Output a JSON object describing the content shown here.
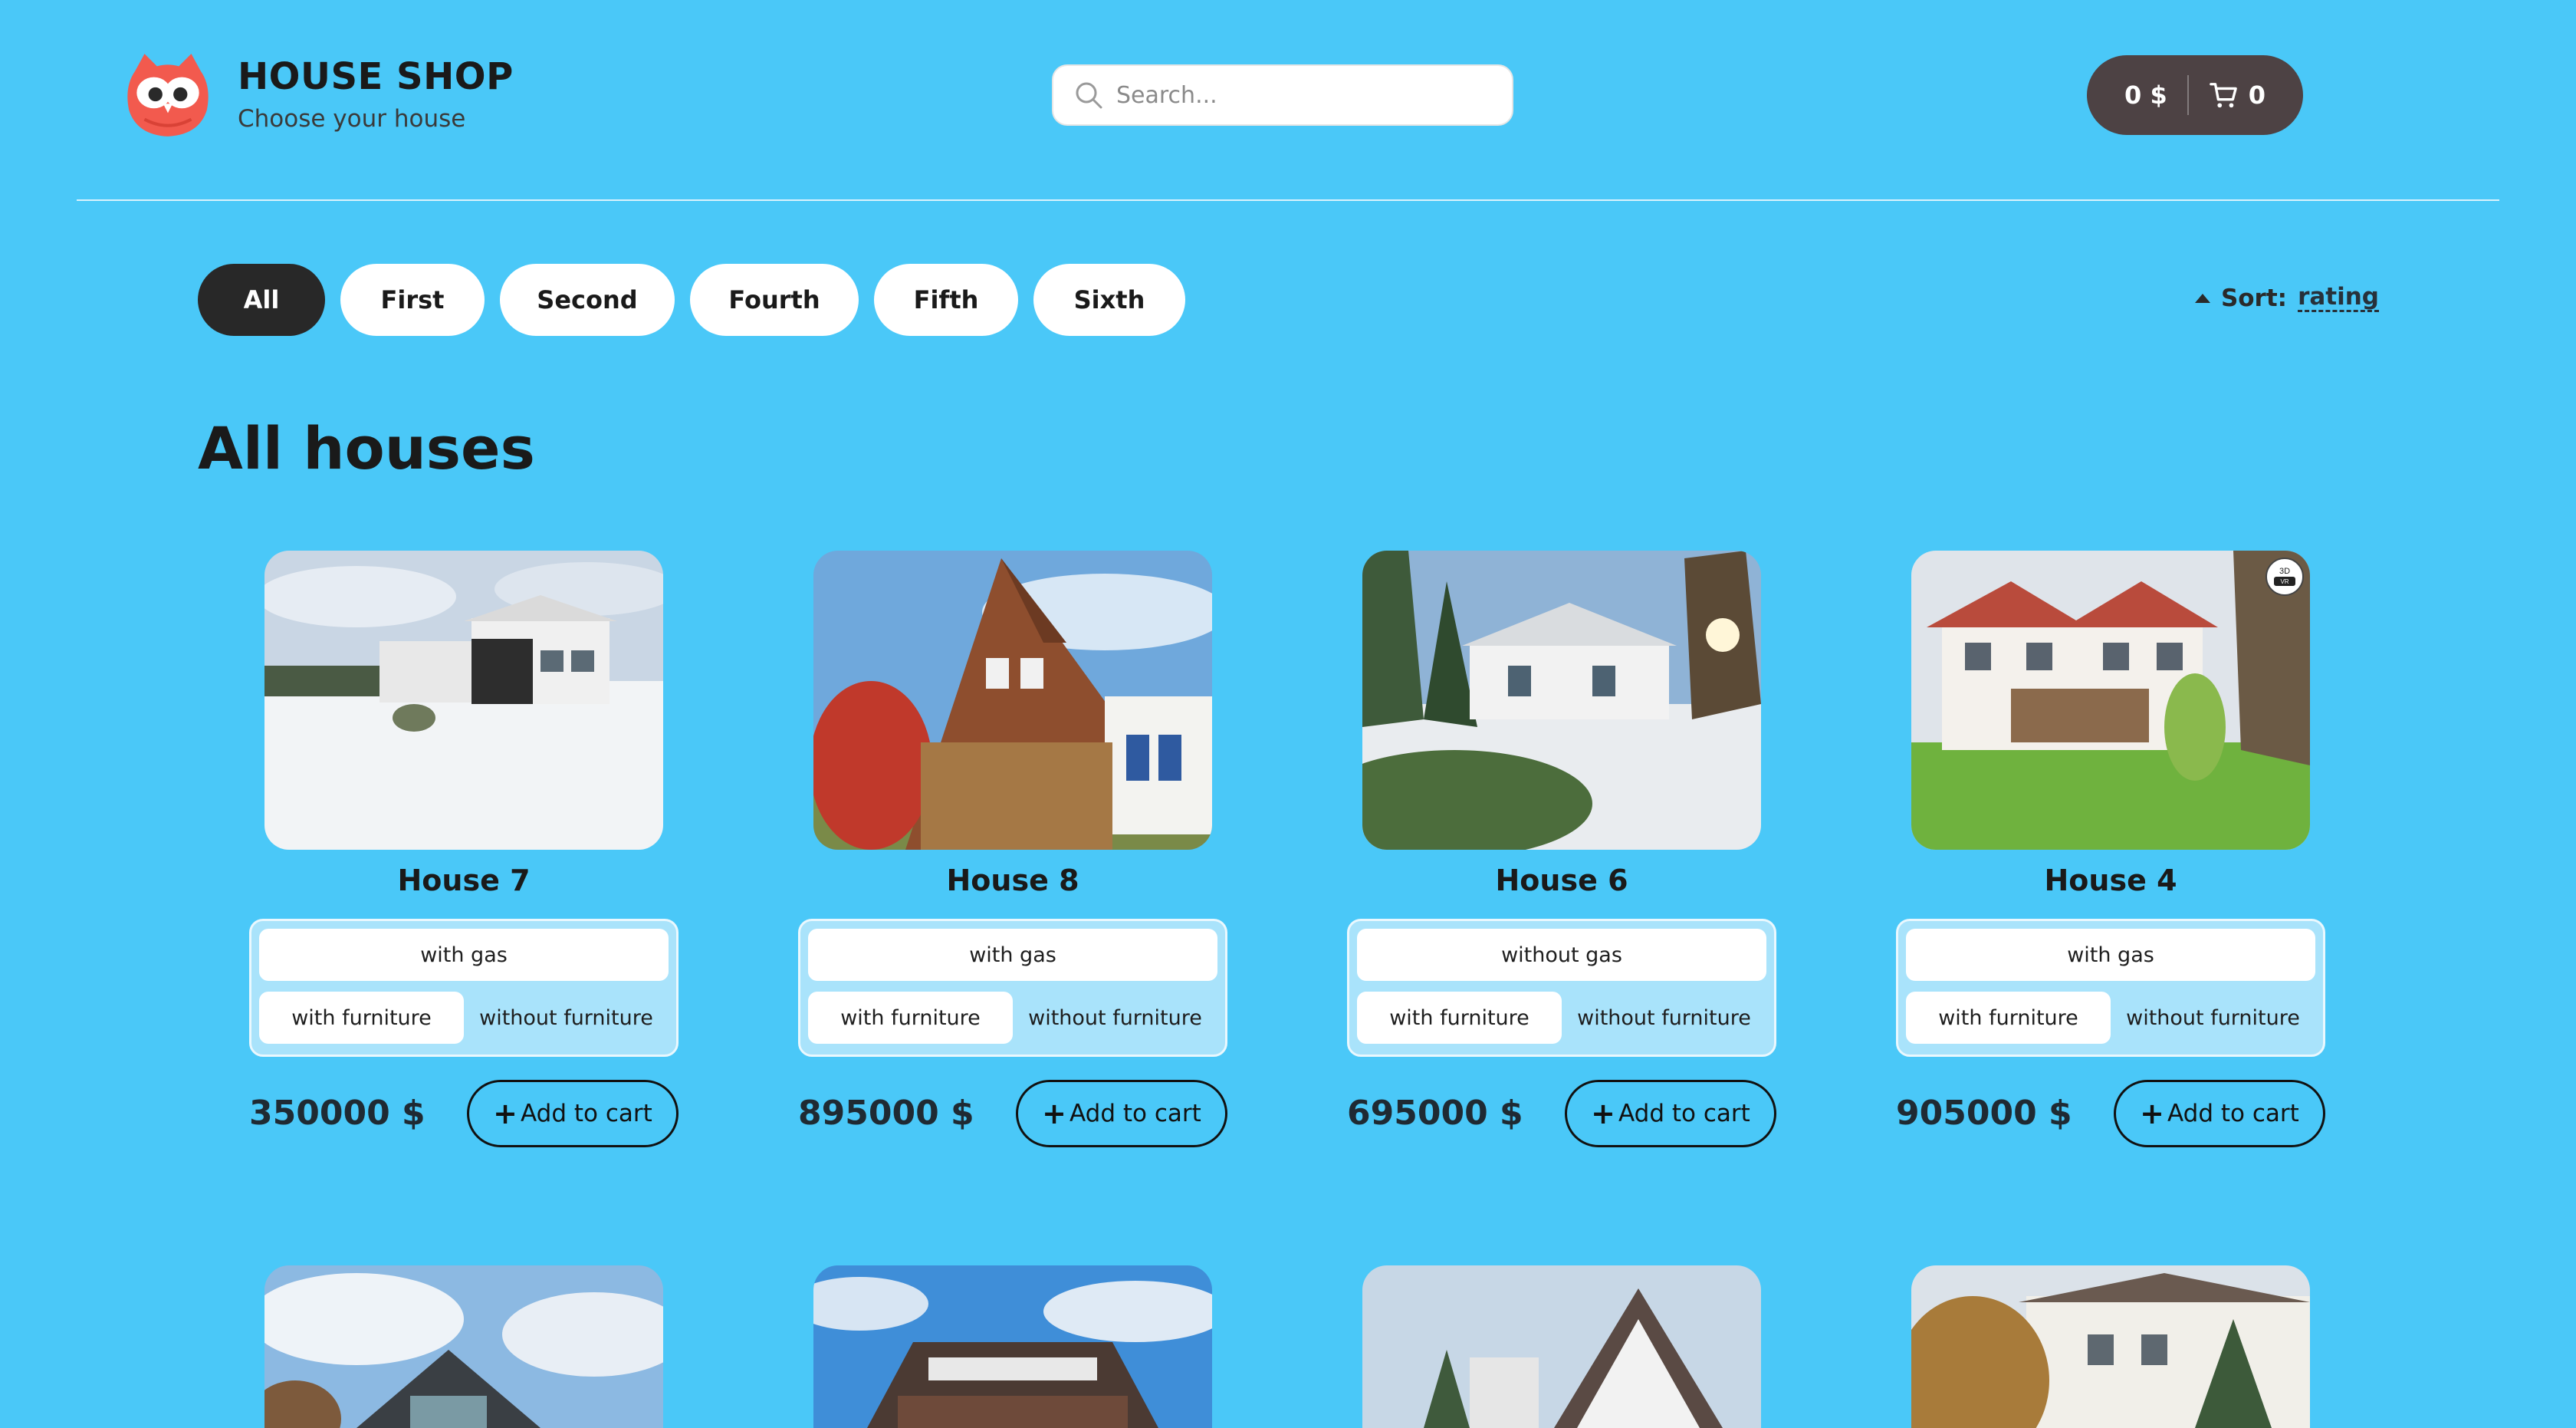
{
  "brand": {
    "title": "HOUSE SHOP",
    "subtitle": "Choose your house"
  },
  "search": {
    "placeholder": "Search..."
  },
  "cart": {
    "total": "0 $",
    "count": "0"
  },
  "categories": [
    {
      "label": "All",
      "active": true
    },
    {
      "label": "First"
    },
    {
      "label": "Second"
    },
    {
      "label": "Fourth"
    },
    {
      "label": "Fifth"
    },
    {
      "label": "Sixth"
    }
  ],
  "sort": {
    "label": "Sort:",
    "value": "rating"
  },
  "section_title": "All houses",
  "products": [
    {
      "name": "House 7",
      "gas": "with gas",
      "furniture_on": "with furniture",
      "furniture_off": "without furniture",
      "price": "350000 $",
      "add_label": "Add to cart"
    },
    {
      "name": "House 8",
      "gas": "with gas",
      "furniture_on": "with furniture",
      "furniture_off": "without furniture",
      "price": "895000 $",
      "add_label": "Add to cart"
    },
    {
      "name": "House 6",
      "gas": "without gas",
      "furniture_on": "with furniture",
      "furniture_off": "without furniture",
      "price": "695000 $",
      "add_label": "Add to cart"
    },
    {
      "name": "House 4",
      "gas": "with gas",
      "furniture_on": "with furniture",
      "furniture_off": "without furniture",
      "price": "905000 $",
      "add_label": "Add to cart"
    }
  ]
}
